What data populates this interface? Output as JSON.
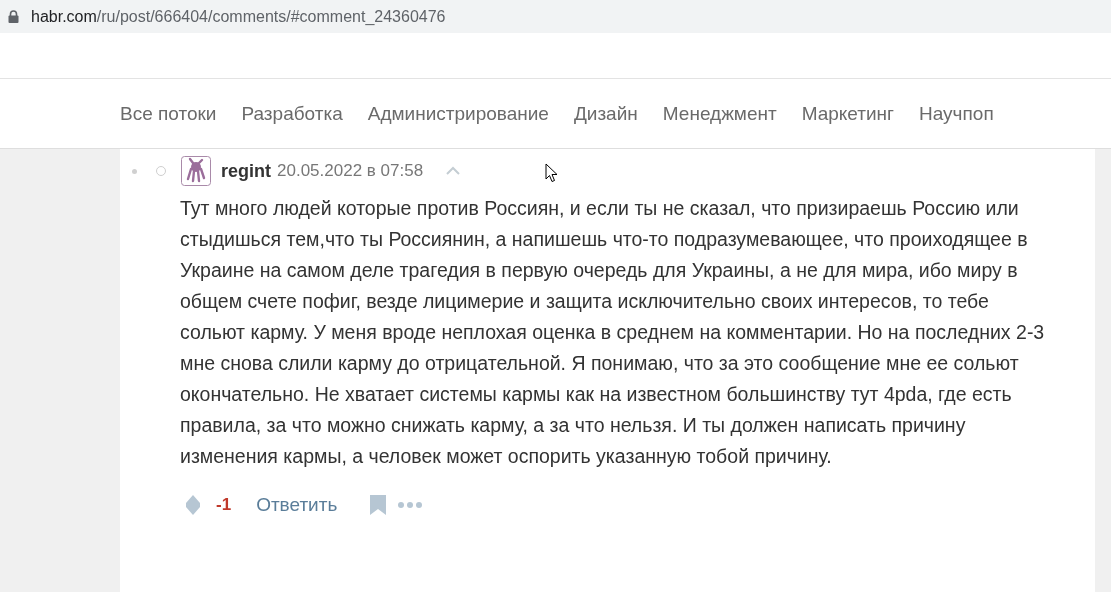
{
  "address_bar": {
    "host": "habr.com",
    "path": "/ru/post/666404/comments/#comment_24360476"
  },
  "nav": {
    "items": [
      "Все потоки",
      "Разработка",
      "Администрирование",
      "Дизайн",
      "Менеджмент",
      "Маркетинг",
      "Научпоп"
    ]
  },
  "comment": {
    "author": "regint",
    "date": "20.05.2022 в 07:58",
    "text": "Тут много людей которые против Россиян, и если ты не сказал, что призираешь Россию или стыдишься тем,что ты Россиянин, а напишешь что-то подразумевающее, что проиходящее в Украине на самом деле трагедия в первую очередь для Украины, а не для мира, ибо миру в общем счете пофиг, везде лицимерие и защита исключительно своих интересов, то тебе сольют карму. У меня вроде неплохая оценка в среднем на комментарии. Но на последних 2-3 мне снова слили карму до отрицательной. Я понимаю, что за это сообщение мне ее сольют окончательно. Не хватает системы кармы как на известном большинству тут 4pda, где есть правила, за что можно снижать карму, а за что нельзя. И ты должен написать причину изменения кармы, а человек может оспорить указанную тобой причину.",
    "score": "-1",
    "score_negative": true,
    "reply": "Ответить"
  }
}
